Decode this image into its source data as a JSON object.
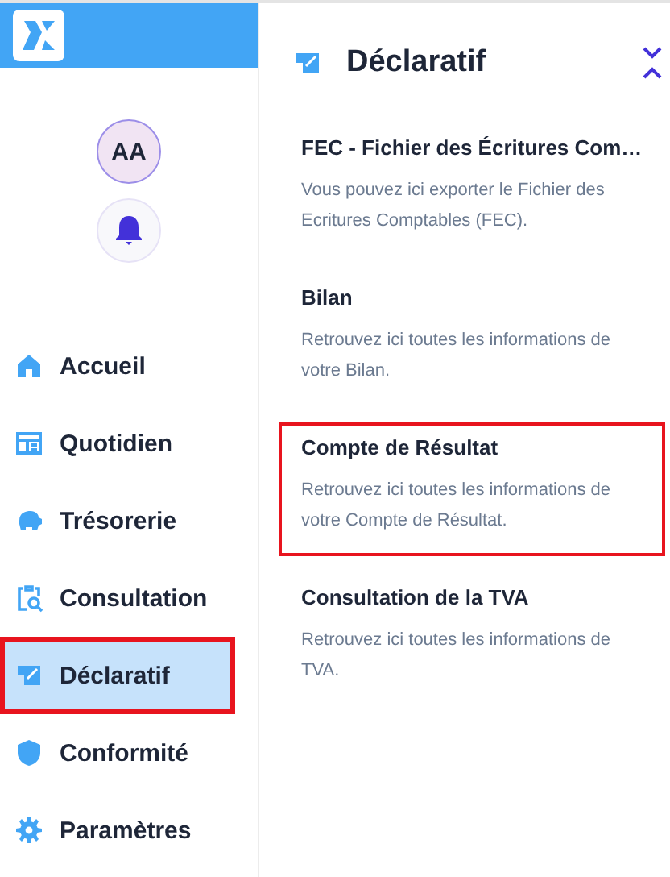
{
  "user": {
    "initials": "AA"
  },
  "nav": [
    {
      "label": "Accueil",
      "selected": false,
      "highlighted": false
    },
    {
      "label": "Quotidien",
      "selected": false,
      "highlighted": false
    },
    {
      "label": "Trésorerie",
      "selected": false,
      "highlighted": false
    },
    {
      "label": "Consultation",
      "selected": false,
      "highlighted": false
    },
    {
      "label": "Déclaratif",
      "selected": true,
      "highlighted": true
    },
    {
      "label": "Conformité",
      "selected": false,
      "highlighted": false
    },
    {
      "label": "Paramètres",
      "selected": false,
      "highlighted": false
    }
  ],
  "panel": {
    "title": "Déclaratif",
    "items": [
      {
        "title": "FEC - Fichier des Écritures Com…",
        "description": "Vous pouvez ici exporter le Fichier des Ecritures Comptables (FEC).",
        "highlighted": false
      },
      {
        "title": "Bilan",
        "description": "Retrouvez ici toutes les informations de votre Bilan.",
        "highlighted": false
      },
      {
        "title": "Compte de Résultat",
        "description": "Retrouvez ici toutes les informations de votre Compte de Résultat.",
        "highlighted": true
      },
      {
        "title": "Consultation de la TVA",
        "description": "Retrouvez ici toutes les informations de TVA.",
        "highlighted": false
      }
    ]
  }
}
